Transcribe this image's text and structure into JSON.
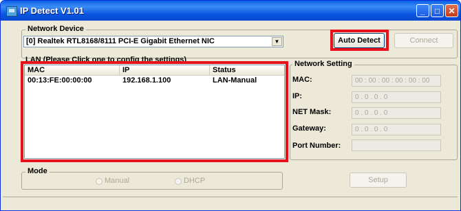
{
  "window": {
    "title": "IP Detect V1.01"
  },
  "network_device": {
    "label": "Network Device",
    "selected": "[0] Realtek RTL8168/8111 PCI-E Gigabit Ethernet NIC"
  },
  "buttons": {
    "auto_detect": "Auto Detect",
    "connect": "Connect",
    "setup": "Setup"
  },
  "lan": {
    "label": "LAN (Please Click one to config the settings)",
    "columns": [
      "MAC",
      "IP",
      "Status"
    ],
    "rows": [
      {
        "mac": "00:13:FE:00:00:00",
        "ip": "192.168.1.100",
        "status": "LAN-Manual"
      }
    ]
  },
  "network_setting": {
    "label": "Network Setting",
    "mac_label": "MAC:",
    "mac_value": "00 : 00 : 00 : 00 : 00 : 00",
    "ip_label": "IP:",
    "ip_value": "0 .  0 .  0 .  0",
    "mask_label": "NET Mask:",
    "mask_value": "0 .  0 .  0 .  0",
    "gateway_label": "Gateway:",
    "gateway_value": "0 .  0 .  0 .  0",
    "port_label": "Port Number:",
    "port_value": ""
  },
  "mode": {
    "label": "Mode",
    "options": [
      "Manual",
      "DHCP"
    ]
  },
  "colors": {
    "highlight": "#e8101a",
    "titlebar": "#0a5fe6"
  },
  "icons": [
    "app-icon",
    "minimize-icon",
    "maximize-icon",
    "close-icon"
  ]
}
